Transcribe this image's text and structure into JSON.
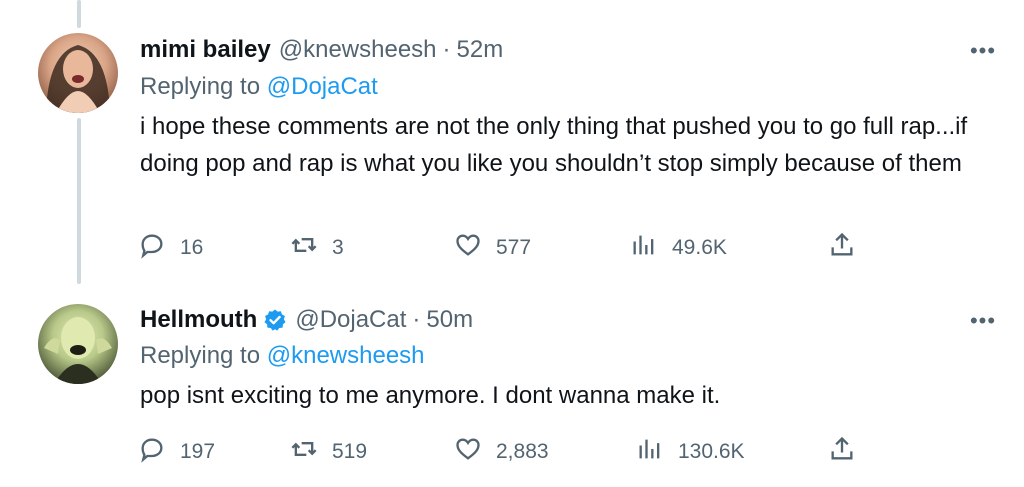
{
  "tweets": [
    {
      "display_name": "mimi bailey",
      "handle": "@knewsheesh",
      "separator": "·",
      "time": "52m",
      "verified": false,
      "replying_prefix": "Replying to",
      "replying_to": "@DojaCat",
      "text": "i hope these comments are not the only thing that pushed you to go full rap...if doing pop and rap is what you like you shouldn’t stop simply because of them",
      "replies": "16",
      "retweets": "3",
      "likes": "577",
      "views": "49.6K"
    },
    {
      "display_name": "Hellmouth",
      "handle": "@DojaCat",
      "separator": "·",
      "time": "50m",
      "verified": true,
      "replying_prefix": "Replying to",
      "replying_to": "@knewsheesh",
      "text": "pop isnt exciting to me anymore. I dont wanna make it.",
      "replies": "197",
      "retweets": "519",
      "likes": "2,883",
      "views": "130.6K"
    }
  ],
  "more_glyph": "•••",
  "icons": {
    "reply": "reply-icon",
    "retweet": "retweet-icon",
    "like": "heart-icon",
    "views": "views-icon",
    "share": "share-icon",
    "verified": "verified-badge-icon"
  },
  "colors": {
    "link": "#1d9bf0",
    "muted": "#536471",
    "text": "#0f1419",
    "thread_line": "#cfd9de"
  }
}
